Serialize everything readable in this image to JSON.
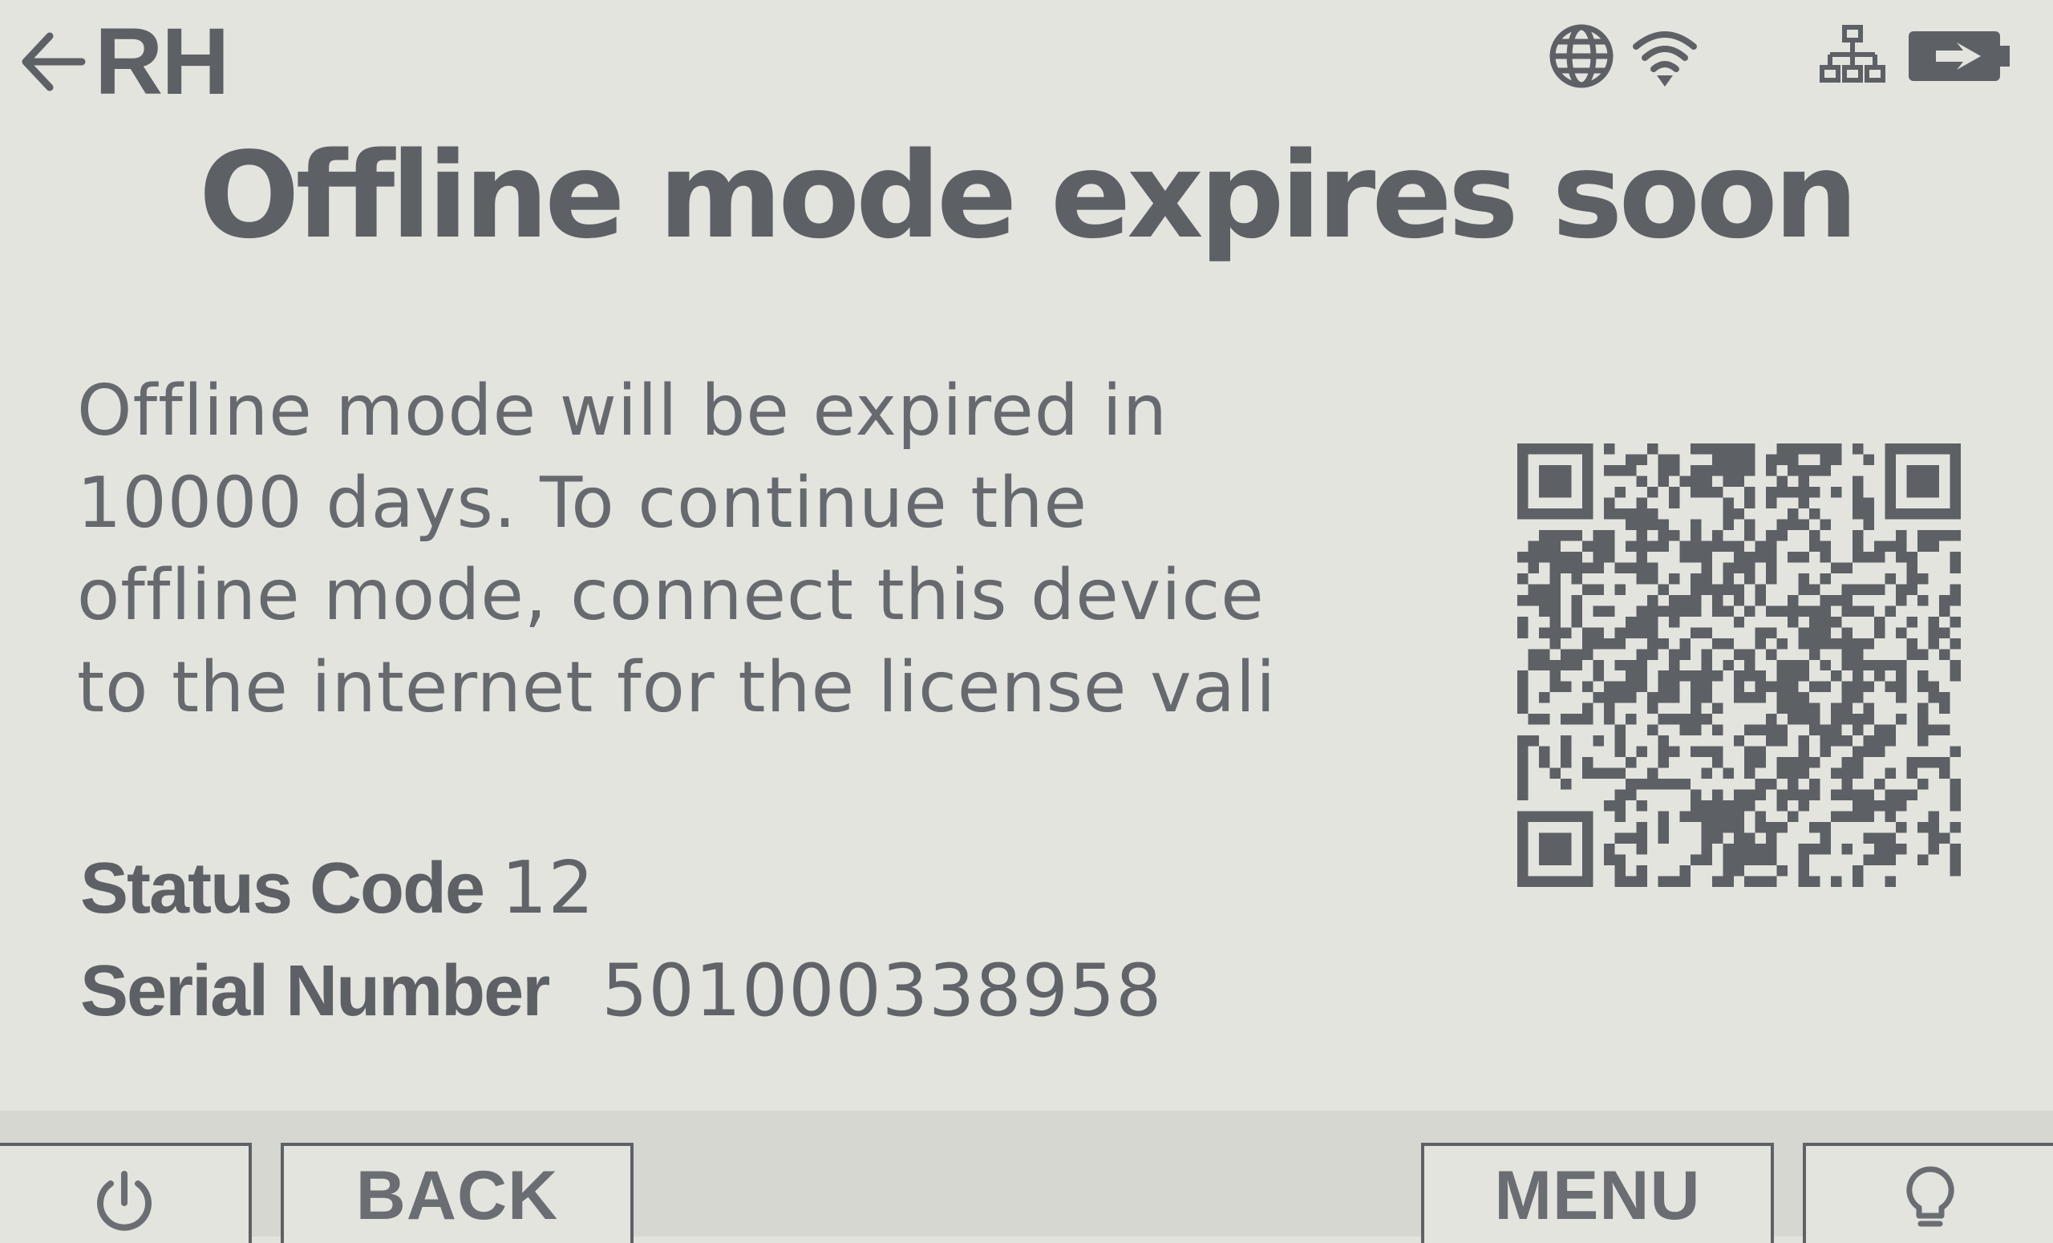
{
  "header": {
    "mode_label": "RH"
  },
  "title": "Offline mode expires soon",
  "message": {
    "lines": [
      "Offline mode will be expired in",
      "10000 days. To continue the",
      "offline mode, connect this device",
      "to the internet for the license vali"
    ]
  },
  "info": {
    "status_label": "Status Code",
    "status_value": "12",
    "serial_label": "Serial Number",
    "serial_value": "501000338958"
  },
  "softkeys": {
    "back": "BACK",
    "menu": "MENU"
  },
  "icons": {
    "back": "arrow-left-icon",
    "globe": "globe-icon",
    "wifi": "wifi-icon",
    "network": "network-icon",
    "battery": "battery-charging-icon",
    "power": "power-icon",
    "light": "lightbulb-icon"
  },
  "colors": {
    "background": "#e3e4de",
    "ink": "#5d6065"
  }
}
